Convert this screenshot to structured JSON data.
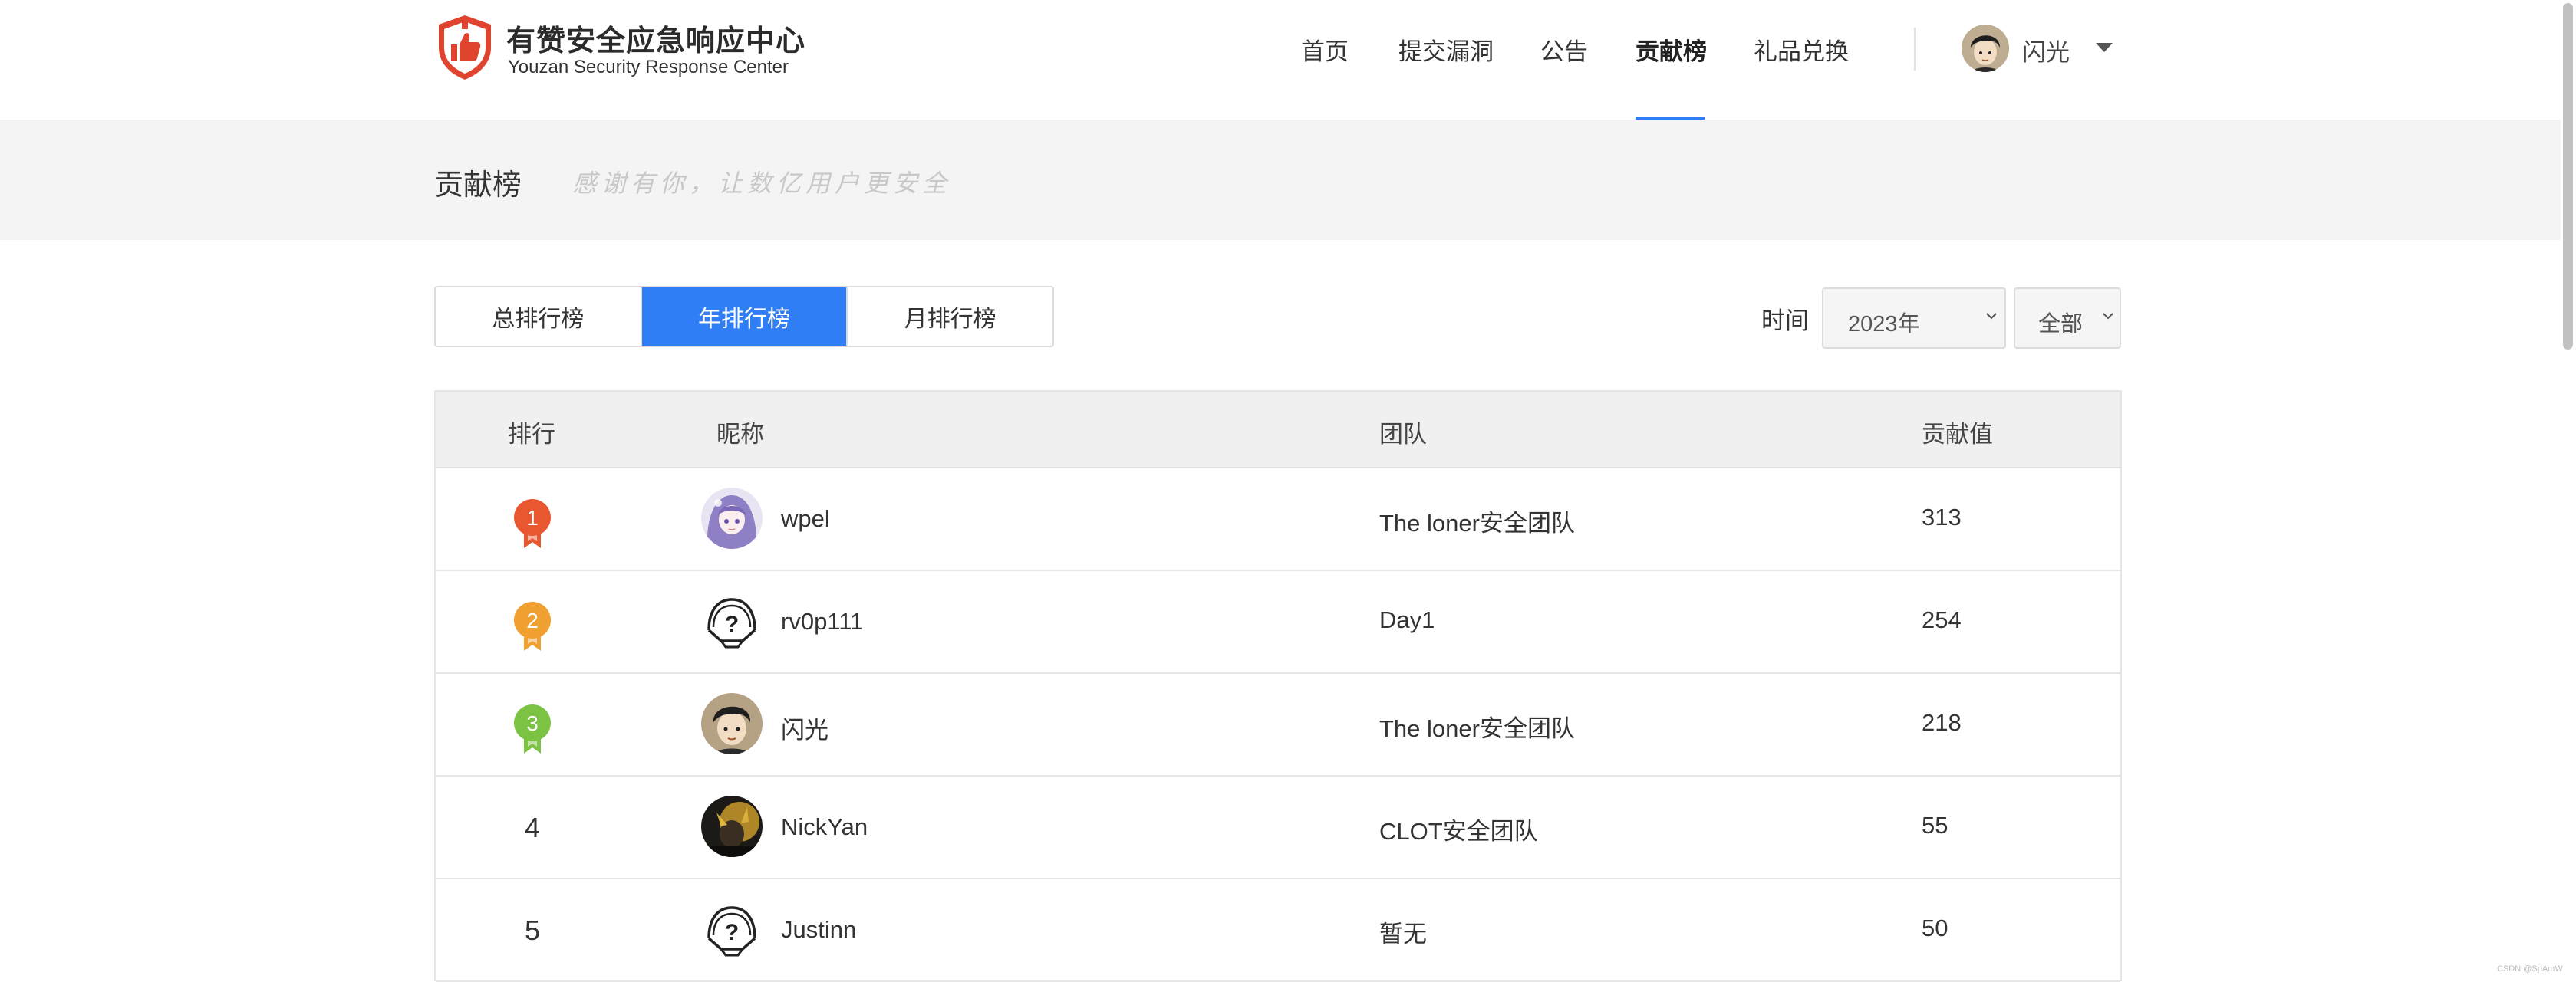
{
  "header": {
    "brand_cn": "有赞安全应急响应中心",
    "brand_en": "Youzan Security Response Center",
    "logo_icon": "shield-thumbs-up-icon",
    "nav": [
      {
        "label": "首页",
        "active": false
      },
      {
        "label": "提交漏洞",
        "active": false
      },
      {
        "label": "公告",
        "active": false
      },
      {
        "label": "贡献榜",
        "active": true
      },
      {
        "label": "礼品兑换",
        "active": false
      }
    ],
    "user": {
      "name": "闪光",
      "avatar_icon": "user-avatar-icon",
      "dropdown_icon": "caret-down-icon"
    }
  },
  "banner": {
    "title": "贡献榜",
    "slogan": "感谢有你，让数亿用户更安全"
  },
  "tabs": [
    {
      "label": "总排行榜",
      "active": false
    },
    {
      "label": "年排行榜",
      "active": true
    },
    {
      "label": "月排行榜",
      "active": false
    }
  ],
  "filter": {
    "time_label": "时间",
    "year": "2023年",
    "type": "全部"
  },
  "table": {
    "headers": {
      "rank": "排行",
      "nickname": "昵称",
      "team": "团队",
      "score": "贡献值"
    },
    "rows": [
      {
        "rank": "1",
        "nickname": "wpel",
        "team": "The loner安全团队",
        "score": "313",
        "avatar": "anime-girl-avatar"
      },
      {
        "rank": "2",
        "nickname": "rv0p111",
        "team": "Day1",
        "score": "254",
        "avatar": "default-question-avatar"
      },
      {
        "rank": "3",
        "nickname": "闪光",
        "team": "The loner安全团队",
        "score": "218",
        "avatar": "cartoon-boy-avatar"
      },
      {
        "rank": "4",
        "nickname": "NickYan",
        "team": "CLOT安全团队",
        "score": "55",
        "avatar": "dark-photo-avatar"
      },
      {
        "rank": "5",
        "nickname": "Justinn",
        "team": "暂无",
        "score": "50",
        "avatar": "default-question-avatar"
      }
    ]
  },
  "colors": {
    "accent": "#2f7ef5",
    "medal_gold": "#e8572f",
    "medal_silver": "#f0a030",
    "medal_bronze": "#7cc243",
    "logo_red": "#e0442f"
  },
  "watermark": "CSDN @SpAmW"
}
